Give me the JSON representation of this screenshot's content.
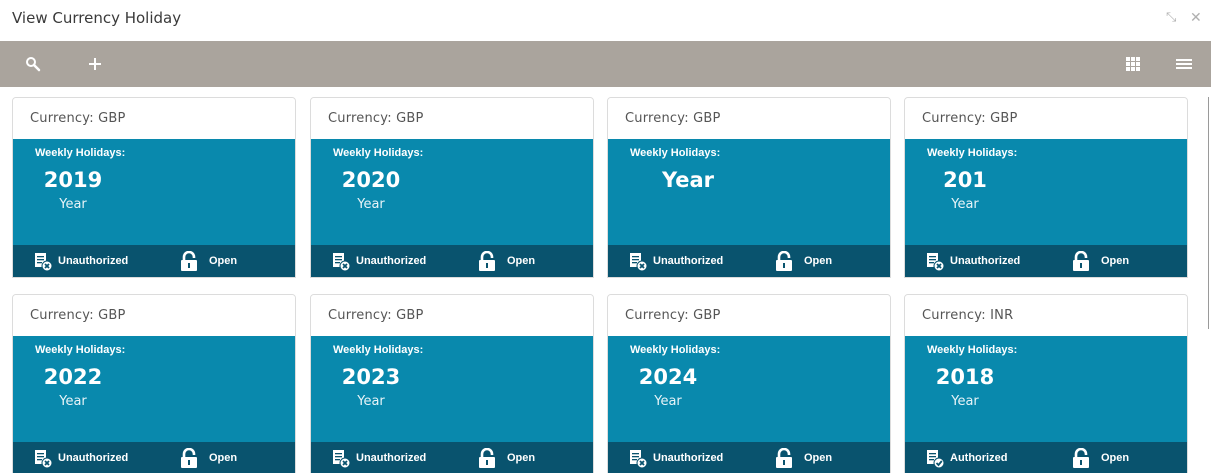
{
  "window": {
    "title": "View Currency Holiday",
    "minimize_glyph": "⤡",
    "close_glyph": "✕"
  },
  "toolbar": {
    "search_icon": "search-icon",
    "add_icon": "plus-icon",
    "grid_view_icon": "grid-icon",
    "list_view_icon": "menu-icon"
  },
  "colors": {
    "toolbar": "#aaa49d",
    "card_body": "#0989ad",
    "card_footer": "#09536e"
  },
  "cards": [
    {
      "currency": "Currency:  GBP",
      "weekly_label": "Weekly Holidays:",
      "year": "2019",
      "year_label": "Year",
      "auth_status": "Unauthorized",
      "lock_status": "Open"
    },
    {
      "currency": "Currency:  GBP",
      "weekly_label": "Weekly Holidays:",
      "year": "2020",
      "year_label": "Year",
      "auth_status": "Unauthorized",
      "lock_status": "Open"
    },
    {
      "currency": "Currency:  GBP",
      "weekly_label": "Weekly Holidays:",
      "year": "",
      "year_label": "Year",
      "auth_status": "Unauthorized",
      "lock_status": "Open"
    },
    {
      "currency": "Currency:  GBP",
      "weekly_label": "Weekly Holidays:",
      "year": "201",
      "year_label": "Year",
      "auth_status": "Unauthorized",
      "lock_status": "Open"
    },
    {
      "currency": "Currency:  GBP",
      "weekly_label": "Weekly Holidays:",
      "year": "2022",
      "year_label": "Year",
      "auth_status": "Unauthorized",
      "lock_status": "Open"
    },
    {
      "currency": "Currency:  GBP",
      "weekly_label": "Weekly Holidays:",
      "year": "2023",
      "year_label": "Year",
      "auth_status": "Unauthorized",
      "lock_status": "Open"
    },
    {
      "currency": "Currency:  GBP",
      "weekly_label": "Weekly Holidays:",
      "year": "2024",
      "year_label": "Year",
      "auth_status": "Unauthorized",
      "lock_status": "Open"
    },
    {
      "currency": "Currency:  INR",
      "weekly_label": "Weekly Holidays:",
      "year": "2018",
      "year_label": "Year",
      "auth_status": "Authorized",
      "lock_status": "Open"
    }
  ]
}
